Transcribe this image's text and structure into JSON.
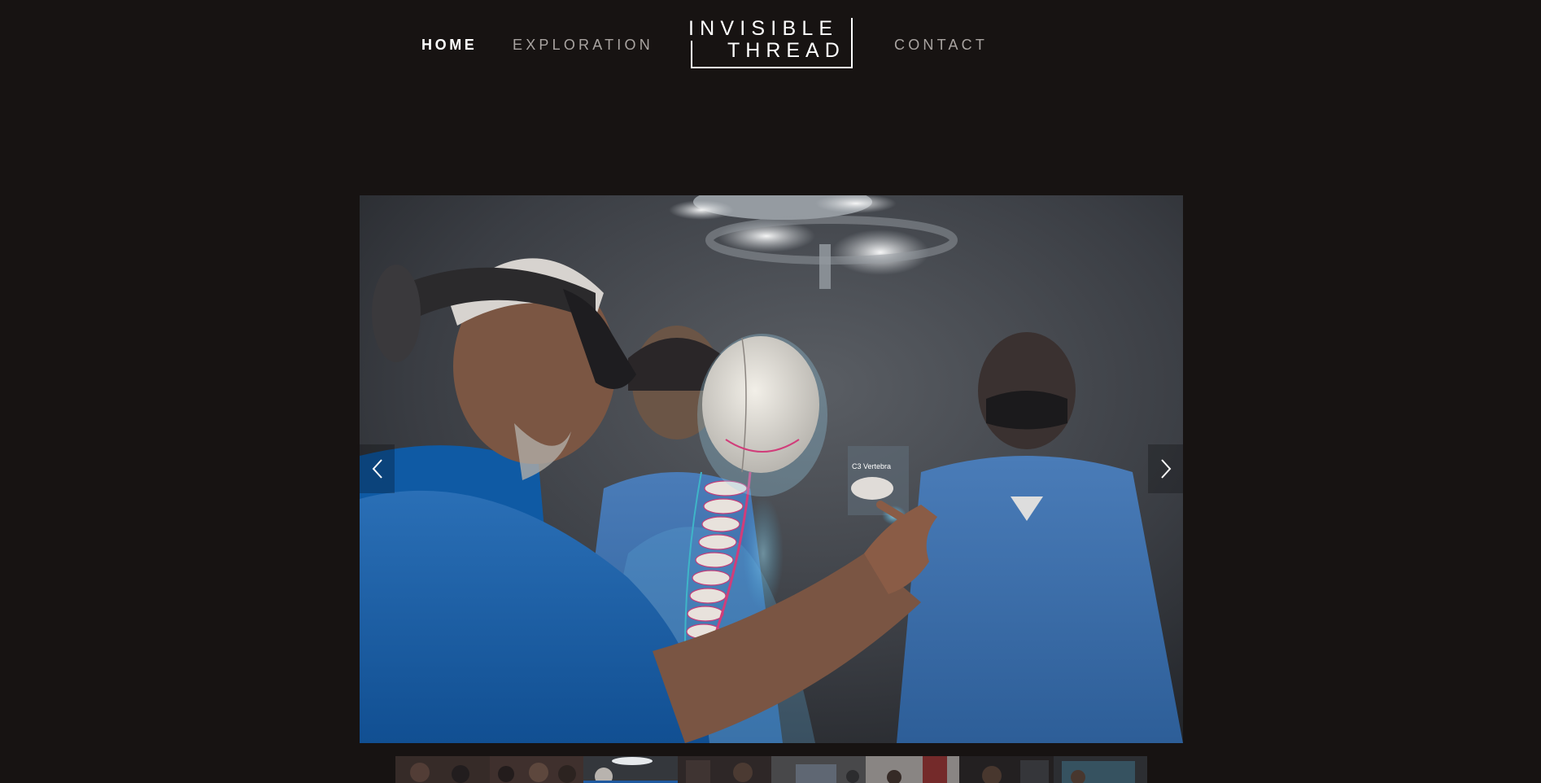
{
  "nav": {
    "home": "HOME",
    "exploration": "EXPLORATION",
    "contact": "CONTACT"
  },
  "logo": {
    "line1": "INVISIBLE",
    "line2": "THREAD"
  },
  "slider": {
    "hologram_label": "C3 Vertebra",
    "prev_icon": "chevron-left-icon",
    "next_icon": "chevron-right-icon",
    "active_thumbnail": 3,
    "thumbnail_count": 8
  },
  "colors": {
    "background": "#171312",
    "nav_active": "#ffffff",
    "nav_inactive": "#a9a4a1"
  }
}
